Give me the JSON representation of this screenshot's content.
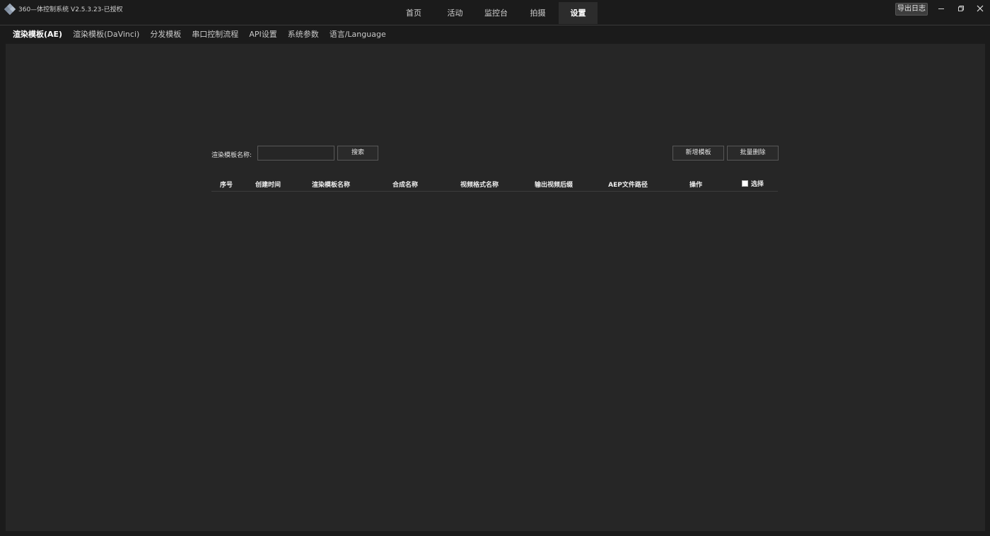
{
  "app": {
    "title": "360—体控制系统 V2.5.3.23-已授权"
  },
  "nav": {
    "items": [
      {
        "label": "首页",
        "active": false
      },
      {
        "label": "活动",
        "active": false
      },
      {
        "label": "监控台",
        "active": false
      },
      {
        "label": "拍摄",
        "active": false
      },
      {
        "label": "设置",
        "active": true
      }
    ]
  },
  "window": {
    "export_log_label": "导出日志",
    "controls": [
      "minimize-icon",
      "restore-icon",
      "close-icon"
    ]
  },
  "subtabs": [
    {
      "label": "渲染模板(AE)",
      "active": true
    },
    {
      "label": "渲染模板(DaVinci)",
      "active": false
    },
    {
      "label": "分发模板",
      "active": false
    },
    {
      "label": "串口控制流程",
      "active": false
    },
    {
      "label": "API设置",
      "active": false
    },
    {
      "label": "系统参数",
      "active": false
    },
    {
      "label": "语言/Language",
      "active": false
    }
  ],
  "toolbar": {
    "search_label": "渲染模板名称:",
    "search_value": "",
    "search_button": "搜索",
    "add_button": "新增模板",
    "batch_delete_button": "批量删除"
  },
  "table": {
    "columns": [
      "序号",
      "创建时间",
      "渲染模板名称",
      "合成名称",
      "视频格式名称",
      "输出视频后缀",
      "AEP文件路径",
      "操作"
    ],
    "select_label": "选择",
    "rows": []
  },
  "colors": {
    "background": "#1b1b1b",
    "panel": "#262626",
    "nav_active": "#2c2c2c",
    "text": "#d8d8d8"
  }
}
